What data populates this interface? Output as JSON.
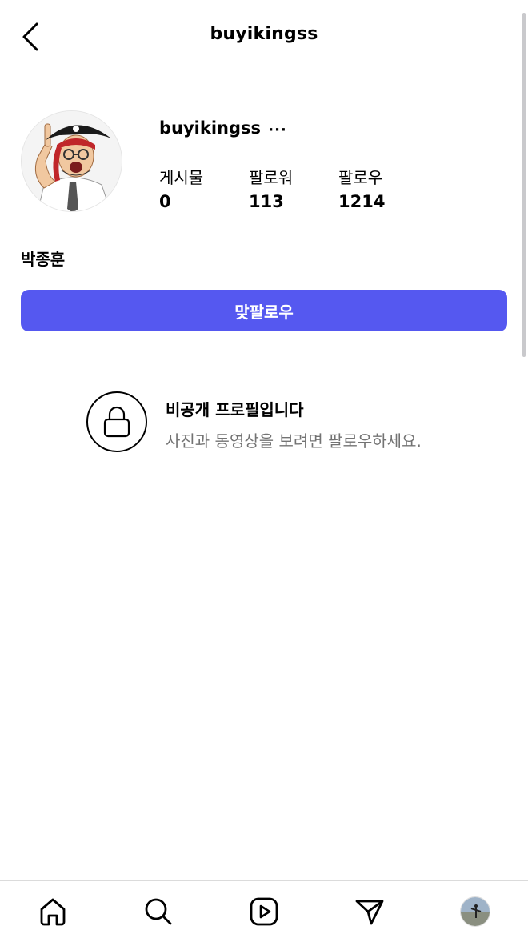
{
  "header": {
    "title": "buyikingss"
  },
  "profile": {
    "username": "buyikingss",
    "more_label": "···",
    "stats": [
      {
        "label": "게시물",
        "value": "0"
      },
      {
        "label": "팔로워",
        "value": "113"
      },
      {
        "label": "팔로우",
        "value": "1214"
      }
    ],
    "name": "박종훈",
    "follow_back_label": "맞팔로우"
  },
  "private_notice": {
    "title": "비공개 프로필입니다",
    "subtitle": "사진과 동영상을 보려면 팔로우하세요."
  },
  "bottom_nav": {
    "items": [
      "home-icon",
      "search-icon",
      "reels-icon",
      "send-icon",
      "profile-avatar"
    ]
  },
  "colors": {
    "accent": "#5558F0",
    "muted_text": "#737373",
    "divider": "#DBDBDB"
  }
}
